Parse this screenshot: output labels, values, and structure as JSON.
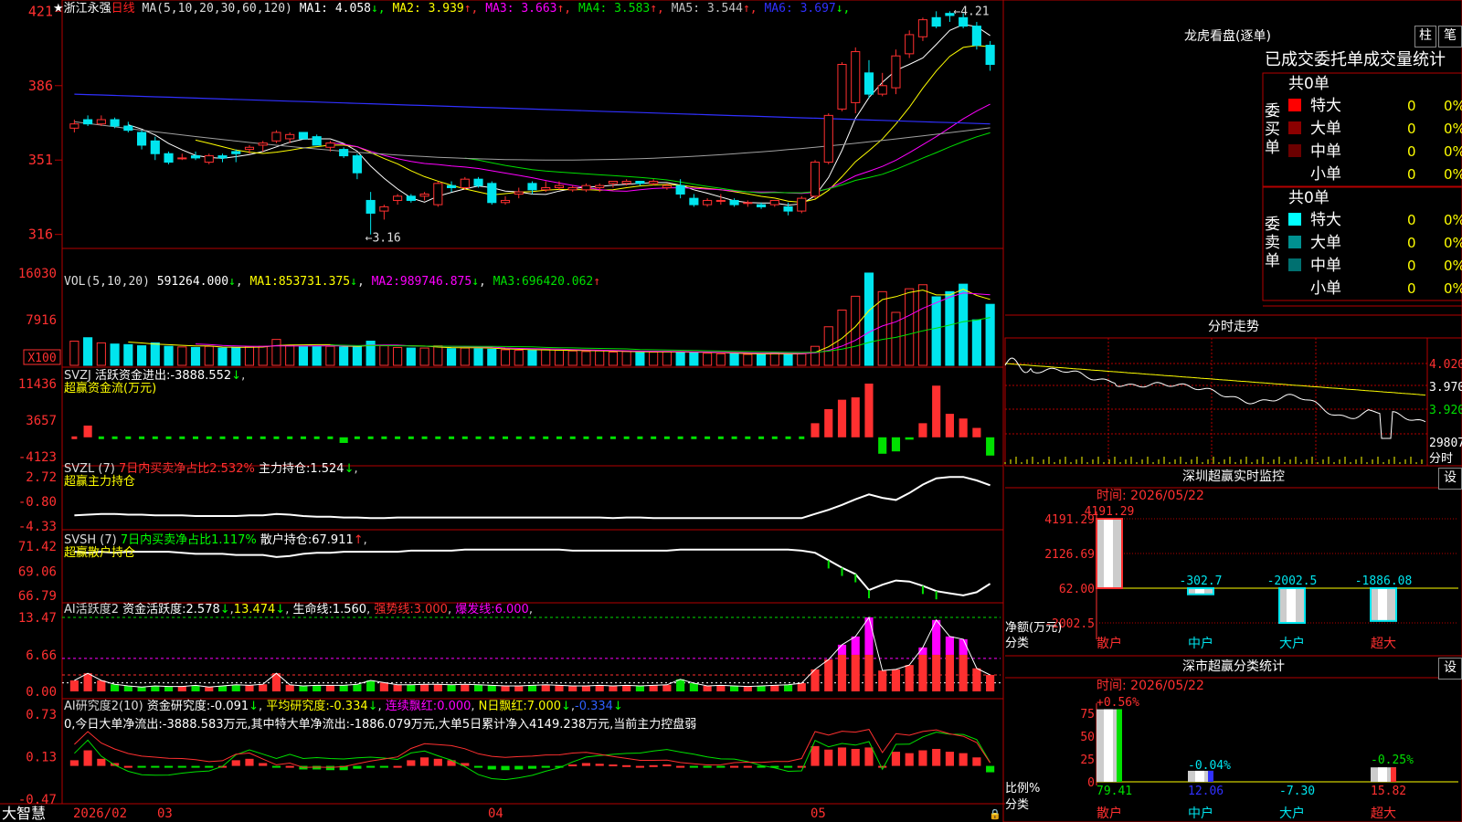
{
  "colors": {
    "up": "#ff3030",
    "down": "#00e5ee",
    "grid": "#b40000",
    "ma1": "#ffffff",
    "ma2": "#ffff00",
    "ma3": "#ff00ff",
    "ma4": "#00e000",
    "ma5": "#a0a0a0",
    "ma6": "#3030ff"
  },
  "kline": {
    "name": "★浙江永强",
    "period": "日线",
    "ma_label": "MA(5,10,20,30,60,120)",
    "ma_values": [
      {
        "label": "MA1:",
        "value": "4.058",
        "arrow": "↓",
        "color": "#ffffff"
      },
      {
        "label": "MA2:",
        "value": "3.939",
        "arrow": "↑",
        "color": "#ffff00"
      },
      {
        "label": "MA3:",
        "value": "3.663",
        "arrow": "↑",
        "color": "#ff00ff"
      },
      {
        "label": "MA4:",
        "value": "3.583",
        "arrow": "↑",
        "color": "#00e000"
      },
      {
        "label": "MA5:",
        "value": "3.544",
        "arrow": "↑",
        "color": "#c0c0c0"
      },
      {
        "label": "MA6:",
        "value": "3.697",
        "arrow": "↓",
        "color": "#3030ff"
      }
    ],
    "y_ticks": [
      "421",
      "386",
      "351",
      "316"
    ],
    "high_mark": "4.21",
    "low_mark": "3.16"
  },
  "vol": {
    "title": "VOL(5,10,20)",
    "value": "591264.000",
    "ma1": "853731.375",
    "ma2": "989746.875",
    "ma3": "696420.062",
    "y_ticks": [
      "16030",
      "7916"
    ],
    "unit": "X100"
  },
  "svzj": {
    "title": "SVZJ",
    "t1": "活跃资金进出:",
    "v1": "-3888.552",
    "sub": "超赢资金流(万元)",
    "y_ticks": [
      "11436",
      "3657",
      "-4123"
    ]
  },
  "svzl": {
    "title": "SVZL (7)",
    "t1": "7日内买卖净占比2.532%",
    "t2": "主力持仓:",
    "v2": "1.524",
    "sub": "超赢主力持仓",
    "y_ticks": [
      "2.72",
      "-0.80",
      "-4.33"
    ]
  },
  "svsh": {
    "title": "SVSH (7)",
    "t1": "7日内买卖净占比1.117%",
    "t2": "散户持仓:",
    "v2": "67.911",
    "sub": "超赢散户持仓",
    "y_ticks": [
      "71.42",
      "69.06",
      "66.79"
    ]
  },
  "ai1": {
    "title": "AI活跃度2",
    "t1": "资金活跃度:",
    "v1": "2.578",
    "v2": "13.474",
    "t3": "生命线:",
    "v3": "1.560",
    "t4": "强势线:",
    "v4": "3.000",
    "t5": "爆发线:",
    "v5": "6.000",
    "y_ticks": [
      "13.47",
      "6.66",
      "0.00"
    ]
  },
  "ai2": {
    "title": "AI研究度2(10)",
    "t1": "资金研究度:",
    "v1": "-0.091",
    "t2": "平均研究度:",
    "v2": "-0.334",
    "t3": "连续飘红:",
    "v3": "0.000",
    "t4": "N日飘红:",
    "v4": "7.000",
    "v5": "-0.334",
    "desc": "0,今日大单净流出:-3888.583万元,其中特大单净流出:-1886.079万元,大单5日累计净入4149.238万元,当前主力控盘弱",
    "y_ticks": [
      "0.73",
      "0.13",
      "-0.47"
    ]
  },
  "xaxis": {
    "brand": "大智慧",
    "labels": [
      "2026/02",
      "03",
      "04",
      "05"
    ]
  },
  "right": {
    "dragon_title": "龙虎看盘(逐单)",
    "btn_bar": "柱",
    "btn_pen": "笔",
    "order_header": "已成交委托单成交量统计",
    "buy_label": "委买单",
    "sell_label": "委卖单",
    "buy_total": "共0单",
    "sell_total": "共0单",
    "rows": [
      "特大",
      "大单",
      "中单",
      "小单"
    ],
    "buy_colors": [
      "#ff0000",
      "#8b0000",
      "#6b0000",
      ""
    ],
    "sell_colors": [
      "#00ffff",
      "#009090",
      "#007070",
      ""
    ],
    "row_val": "0",
    "row_pct": "0%",
    "intraday_title": "分时走势",
    "intraday_ticks": [
      "4.020",
      "3.970",
      "3.920",
      "29807",
      "分时"
    ],
    "sz_title": "深圳超赢实时监控",
    "set": "设",
    "sz_time": "时间: 2026/05/22",
    "sz_ticks": [
      "4191.29",
      "2126.69",
      "62.00",
      "-2002.5"
    ],
    "sz_bar_vals": [
      "4191.29",
      "-302.7",
      "-2002.5",
      "-1886.08"
    ],
    "sz_ylabel1": "净额(万元)",
    "sz_ylabel2": "分类",
    "cats": [
      "散户",
      "中户",
      "大户",
      "超大"
    ],
    "cls_title": "深市超赢分类统计",
    "cls_time": "时间: 2026/05/22",
    "cls_ticks": [
      "75",
      "50",
      "25",
      "0"
    ],
    "cls_top": [
      "+0.56%",
      "-0.04%",
      "-0.25%"
    ],
    "cls_vals": [
      "79.41",
      "12.06",
      "-7.30",
      "15.82"
    ],
    "cls_ylabel1": "比例%",
    "cls_ylabel2": "分类"
  },
  "chart_data": {
    "type": "candlestick",
    "ohlc": [
      [
        3.66,
        3.7,
        3.64,
        3.68
      ],
      [
        3.7,
        3.72,
        3.67,
        3.68
      ],
      [
        3.68,
        3.72,
        3.67,
        3.7
      ],
      [
        3.7,
        3.71,
        3.66,
        3.67
      ],
      [
        3.67,
        3.69,
        3.64,
        3.65
      ],
      [
        3.64,
        3.65,
        3.56,
        3.58
      ],
      [
        3.6,
        3.62,
        3.51,
        3.54
      ],
      [
        3.54,
        3.55,
        3.49,
        3.5
      ],
      [
        3.52,
        3.54,
        3.51,
        3.52
      ],
      [
        3.53,
        3.55,
        3.51,
        3.52
      ],
      [
        3.5,
        3.54,
        3.49,
        3.53
      ],
      [
        3.53,
        3.54,
        3.5,
        3.52
      ],
      [
        3.55,
        3.56,
        3.5,
        3.54
      ],
      [
        3.56,
        3.58,
        3.54,
        3.57
      ],
      [
        3.58,
        3.6,
        3.55,
        3.59
      ],
      [
        3.6,
        3.65,
        3.59,
        3.64
      ],
      [
        3.61,
        3.64,
        3.59,
        3.63
      ],
      [
        3.64,
        3.64,
        3.61,
        3.61
      ],
      [
        3.62,
        3.63,
        3.58,
        3.58
      ],
      [
        3.57,
        3.6,
        3.55,
        3.59
      ],
      [
        3.56,
        3.57,
        3.52,
        3.53
      ],
      [
        3.53,
        3.54,
        3.42,
        3.45
      ],
      [
        3.32,
        3.36,
        3.16,
        3.26
      ],
      [
        3.27,
        3.3,
        3.23,
        3.29
      ],
      [
        3.32,
        3.35,
        3.3,
        3.34
      ],
      [
        3.34,
        3.35,
        3.31,
        3.32
      ],
      [
        3.34,
        3.36,
        3.32,
        3.35
      ],
      [
        3.3,
        3.41,
        3.29,
        3.4
      ],
      [
        3.39,
        3.41,
        3.36,
        3.38
      ],
      [
        3.38,
        3.43,
        3.37,
        3.42
      ],
      [
        3.42,
        3.43,
        3.38,
        3.39
      ],
      [
        3.4,
        3.41,
        3.3,
        3.31
      ],
      [
        3.31,
        3.34,
        3.3,
        3.32
      ],
      [
        3.35,
        3.38,
        3.33,
        3.36
      ],
      [
        3.4,
        3.41,
        3.35,
        3.37
      ],
      [
        3.37,
        3.41,
        3.36,
        3.38
      ],
      [
        3.38,
        3.41,
        3.37,
        3.39
      ],
      [
        3.37,
        3.39,
        3.36,
        3.38
      ],
      [
        3.37,
        3.4,
        3.36,
        3.39
      ],
      [
        3.38,
        3.4,
        3.36,
        3.39
      ],
      [
        3.4,
        3.41,
        3.38,
        3.41
      ],
      [
        3.4,
        3.42,
        3.39,
        3.41
      ],
      [
        3.41,
        3.41,
        3.39,
        3.4
      ],
      [
        3.4,
        3.42,
        3.39,
        3.41
      ],
      [
        3.38,
        3.4,
        3.37,
        3.39
      ],
      [
        3.39,
        3.42,
        3.33,
        3.35
      ],
      [
        3.33,
        3.35,
        3.29,
        3.3
      ],
      [
        3.3,
        3.33,
        3.29,
        3.32
      ],
      [
        3.32,
        3.35,
        3.3,
        3.32
      ],
      [
        3.32,
        3.33,
        3.29,
        3.3
      ],
      [
        3.31,
        3.32,
        3.29,
        3.31
      ],
      [
        3.3,
        3.31,
        3.28,
        3.29
      ],
      [
        3.3,
        3.32,
        3.29,
        3.32
      ],
      [
        3.29,
        3.31,
        3.25,
        3.27
      ],
      [
        3.27,
        3.34,
        3.26,
        3.33
      ],
      [
        3.34,
        3.51,
        3.33,
        3.5
      ],
      [
        3.5,
        3.73,
        3.49,
        3.72
      ],
      [
        3.75,
        3.97,
        3.74,
        3.96
      ],
      [
        3.78,
        4.04,
        3.73,
        4.02
      ],
      [
        3.92,
        3.98,
        3.8,
        3.82
      ],
      [
        3.82,
        3.92,
        3.81,
        3.86
      ],
      [
        3.85,
        4.03,
        3.82,
        4.0
      ],
      [
        4.01,
        4.12,
        3.99,
        4.1
      ],
      [
        4.09,
        4.18,
        4.07,
        4.17
      ],
      [
        4.18,
        4.21,
        4.13,
        4.14
      ],
      [
        4.2,
        4.21,
        4.16,
        4.19
      ],
      [
        4.18,
        4.2,
        4.13,
        4.14
      ],
      [
        4.14,
        4.16,
        4.03,
        4.05
      ],
      [
        4.05,
        4.07,
        3.93,
        3.96
      ]
    ],
    "vol_x100": [
      4200,
      4800,
      3900,
      3700,
      3600,
      3400,
      3900,
      3300,
      3200,
      3100,
      3300,
      3000,
      3100,
      3200,
      3300,
      4500,
      3500,
      3300,
      3300,
      3300,
      3200,
      3300,
      4200,
      3400,
      3100,
      3000,
      3000,
      3400,
      2900,
      3000,
      2900,
      2800,
      2700,
      2600,
      2600,
      2700,
      2600,
      2500,
      2400,
      2500,
      2300,
      2400,
      2200,
      2300,
      2400,
      2300,
      2200,
      2100,
      2000,
      2000,
      1900,
      1900,
      2200,
      1900,
      2000,
      3300,
      6700,
      9600,
      12000,
      16030,
      12800,
      9200,
      13300,
      14000,
      11900,
      12800,
      14100,
      7900,
      10600
    ],
    "svzj": [
      700,
      2500,
      -300,
      -500,
      -800,
      -300,
      -1000,
      -800,
      -1100,
      -600,
      -300,
      -400,
      -200,
      -300,
      -200,
      -700,
      -300,
      -400,
      -700,
      -800,
      -1200,
      -900,
      -1100,
      -1000,
      -500,
      -400,
      -700,
      -400,
      -900,
      -700,
      -1100,
      -800,
      -700,
      -500,
      -900,
      -600,
      -700,
      -500,
      -600,
      -400,
      -600,
      -700,
      -500,
      -700,
      -800,
      -900,
      -800,
      -500,
      -600,
      -600,
      -400,
      -600,
      -700,
      -1000,
      -1000,
      3000,
      6000,
      8000,
      8500,
      11436,
      -3500,
      -3000,
      -500,
      3000,
      11000,
      5000,
      4000,
      2000,
      -3888
    ],
    "svzl": [
      -2.8,
      -2.7,
      -2.6,
      -2.6,
      -2.7,
      -2.7,
      -2.8,
      -2.8,
      -2.8,
      -2.9,
      -2.9,
      -2.9,
      -2.9,
      -2.8,
      -2.8,
      -2.6,
      -2.7,
      -2.9,
      -3.0,
      -3.0,
      -3.1,
      -3.1,
      -3.2,
      -3.2,
      -3.1,
      -3.1,
      -3.1,
      -3.1,
      -3.1,
      -3.1,
      -3.1,
      -3.1,
      -3.1,
      -3.1,
      -3.1,
      -3.1,
      -3.1,
      -3.1,
      -3.1,
      -3.1,
      -3.2,
      -3.1,
      -3.1,
      -3.2,
      -3.2,
      -3.2,
      -3.2,
      -3.2,
      -3.2,
      -3.2,
      -3.2,
      -3.2,
      -3.2,
      -3.2,
      -3.2,
      -2.6,
      -2.0,
      -1.3,
      -0.5,
      0.2,
      -0.3,
      -0.6,
      0.4,
      1.6,
      2.5,
      2.7,
      2.7,
      2.2,
      1.5
    ],
    "svsh": [
      70.9,
      70.8,
      70.9,
      70.8,
      70.9,
      70.9,
      70.9,
      70.9,
      70.8,
      70.7,
      70.7,
      70.7,
      70.6,
      70.6,
      70.6,
      70.4,
      70.5,
      70.7,
      70.8,
      70.8,
      70.9,
      70.9,
      70.9,
      70.9,
      70.9,
      71.0,
      71.0,
      71.0,
      71.0,
      71.1,
      71.1,
      71.1,
      71.1,
      71.1,
      71.1,
      71.1,
      71.1,
      71.0,
      71.0,
      71.0,
      71.0,
      71.0,
      71.0,
      71.0,
      71.0,
      71.1,
      71.1,
      71.1,
      71.1,
      71.1,
      71.1,
      71.1,
      71.1,
      71.1,
      71.0,
      70.8,
      70.1,
      69.4,
      68.8,
      67.3,
      67.8,
      68.2,
      68.1,
      67.7,
      67.2,
      67.0,
      66.8,
      67.1,
      67.9
    ],
    "ai_active": [
      2.0,
      3.3,
      2.0,
      1.3,
      1.0,
      0.8,
      1.0,
      0.9,
      0.9,
      1.1,
      0.8,
      1.0,
      1.2,
      1.1,
      1.3,
      3.3,
      1.2,
      1.0,
      1.1,
      1.1,
      1.1,
      1.3,
      2.0,
      1.6,
      1.2,
      1.2,
      1.3,
      1.3,
      1.2,
      1.3,
      1.2,
      1.1,
      1.0,
      1.0,
      1.1,
      1.2,
      1.1,
      1.0,
      1.0,
      1.1,
      1.0,
      1.1,
      1.0,
      1.1,
      1.2,
      2.2,
      1.5,
      1.0,
      1.1,
      1.0,
      0.9,
      1.0,
      1.1,
      1.2,
      1.5,
      4.0,
      5.8,
      8.5,
      10.0,
      13.47,
      3.8,
      4.0,
      4.8,
      8.0,
      13.0,
      10.0,
      9.5,
      4.2,
      3.0
    ],
    "ai_research": [
      0.08,
      0.22,
      0.1,
      0.04,
      0.0,
      -0.02,
      -0.02,
      -0.02,
      -0.01,
      -0.01,
      -0.02,
      0.0,
      0.08,
      0.1,
      0.04,
      -0.02,
      0.0,
      -0.05,
      -0.05,
      -0.06,
      -0.06,
      -0.04,
      -0.02,
      -0.01,
      0.0,
      0.08,
      0.12,
      0.1,
      0.08,
      0.04,
      -0.02,
      -0.05,
      -0.06,
      -0.05,
      -0.04,
      -0.02,
      -0.01,
      0.02,
      0.04,
      0.03,
      0.02,
      0.01,
      0.0,
      0.01,
      0.02,
      0.0,
      -0.01,
      -0.02,
      -0.02,
      0.0,
      0.0,
      -0.01,
      -0.01,
      -0.02,
      0.0,
      0.28,
      0.23,
      0.26,
      0.24,
      0.26,
      0.0,
      0.2,
      0.18,
      0.22,
      0.24,
      0.2,
      0.18,
      0.12,
      -0.09
    ]
  }
}
